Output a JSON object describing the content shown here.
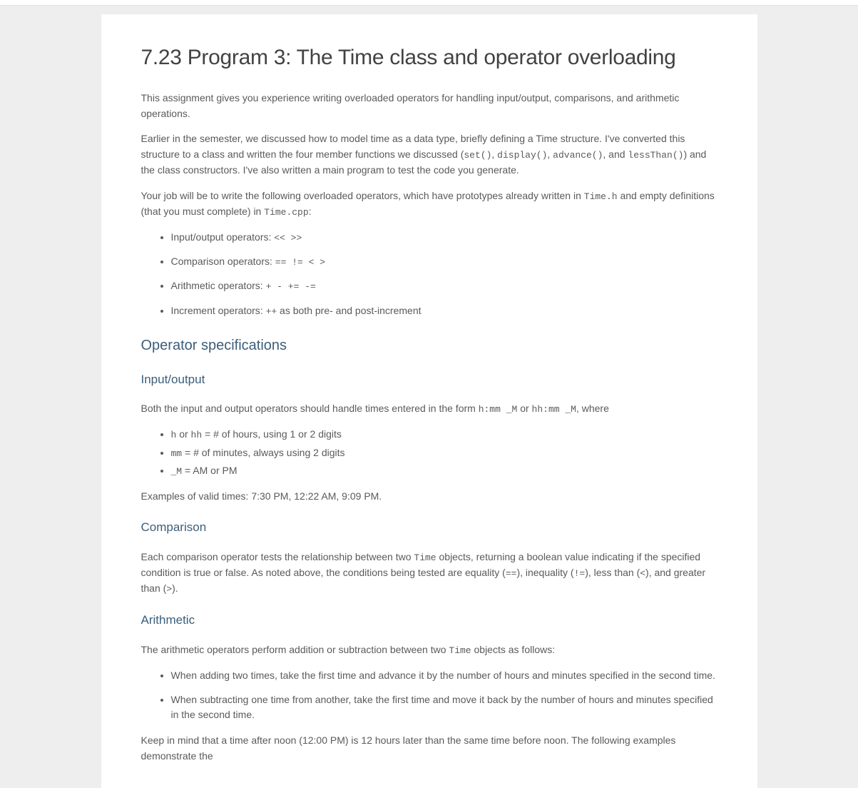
{
  "title": "7.23 Program 3: The Time class and operator overloading",
  "intro": {
    "p1": "This assignment gives you experience writing overloaded operators for handling input/output, comparisons, and arithmetic operations.",
    "p2_pre": "Earlier in the semester, we discussed how to model time as a data type, briefly defining a Time structure. I've converted this structure to a class and written the four member functions we discussed (",
    "p2_c1": "set()",
    "p2_s1": ", ",
    "p2_c2": "display()",
    "p2_s2": ", ",
    "p2_c3": "advance()",
    "p2_s3": ", and ",
    "p2_c4": "lessThan()",
    "p2_post": ") and the class constructors. I've also written a main program to test the code you generate.",
    "p3_pre": "Your job will be to write the following overloaded operators, which have prototypes already written in ",
    "p3_c1": "Time.h",
    "p3_mid": " and empty definitions (that you must complete) in ",
    "p3_c2": "Time.cpp",
    "p3_post": ":"
  },
  "op_list": {
    "io_label": "Input/output operators: ",
    "io_ops": "<< >>",
    "cmp_label": "Comparison operators: ",
    "cmp_ops": "== != < >",
    "arith_label": "Arithmetic operators: ",
    "arith_ops": "+ - += -=",
    "inc_label": "Increment operators: ",
    "inc_op": "++",
    "inc_post": " as both pre- and post-increment"
  },
  "spec_heading": "Operator specifications",
  "io_section": {
    "heading": "Input/output",
    "p1_pre": "Both the input and output operators should handle times entered in the form ",
    "p1_c1": "h:mm _M",
    "p1_mid": " or ",
    "p1_c2": "hh:mm _M",
    "p1_post": ", where",
    "li1_c1": "h",
    "li1_mid": " or ",
    "li1_c2": "hh",
    "li1_post": " = # of hours, using 1 or 2 digits",
    "li2_c1": "mm",
    "li2_post": " = # of minutes, always using 2 digits",
    "li3_c1": "_M",
    "li3_post": " = AM or PM",
    "examples": "Examples of valid times: 7:30 PM, 12:22 AM, 9:09 PM."
  },
  "cmp_section": {
    "heading": "Comparison",
    "p1_pre": "Each comparison operator tests the relationship between two ",
    "p1_c1": "Time",
    "p1_mid": " objects, returning a boolean value indicating if the specified condition is true or false. As noted above, the conditions being tested are equality (",
    "p1_c2": "==",
    "p1_s1": "), inequality (",
    "p1_c3": "!=",
    "p1_s2": "), less than (",
    "p1_c4": "<",
    "p1_s3": "), and greater than (",
    "p1_c5": ">",
    "p1_post": ")."
  },
  "arith_section": {
    "heading": "Arithmetic",
    "p1_pre": "The arithmetic operators perform addition or subtraction between two ",
    "p1_c1": "Time",
    "p1_post": " objects as follows:",
    "li1": "When adding two times, take the first time and advance it by the number of hours and minutes specified in the second time.",
    "li2": "When subtracting one time from another, take the first time and move it back by the number of hours and minutes specified in the second time.",
    "p2": "Keep in mind that a time after noon (12:00 PM) is 12 hours later than the same time before noon. The following examples demonstrate the"
  }
}
